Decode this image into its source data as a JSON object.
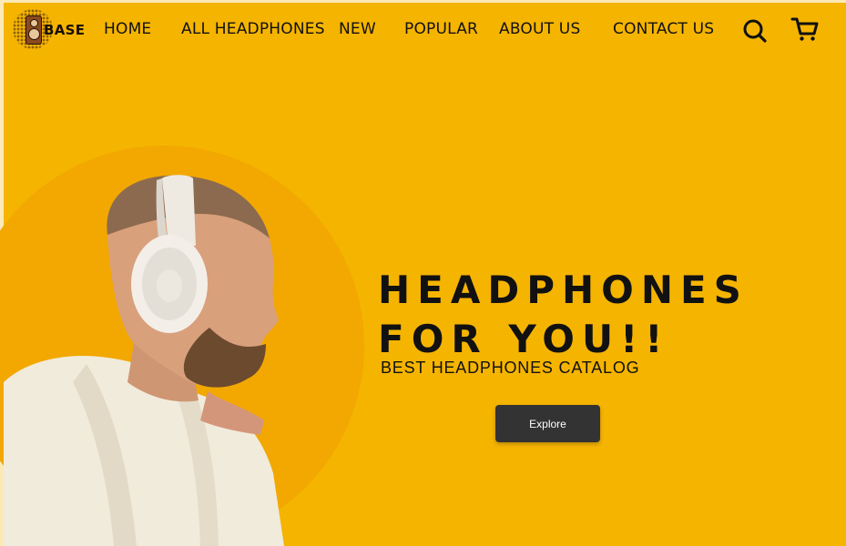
{
  "brand": {
    "name": "BASE"
  },
  "nav": {
    "items": [
      {
        "label": "HOME"
      },
      {
        "label": "ALL HEADPHONES"
      },
      {
        "label": "NEW"
      },
      {
        "label": "POPULAR"
      },
      {
        "label": "ABOUT US"
      },
      {
        "label": "CONTACT US"
      }
    ],
    "search_icon": "search-icon",
    "cart_icon": "cart-icon"
  },
  "hero": {
    "title_line1": "HEADPHONES",
    "title_line2": "FOR YOU!!",
    "subtitle": "BEST HEADPHONES CATALOG",
    "cta_label": "Explore"
  },
  "colors": {
    "background": "#f5b400",
    "halo": "#f2a800",
    "button": "#333333",
    "text": "#111111"
  }
}
